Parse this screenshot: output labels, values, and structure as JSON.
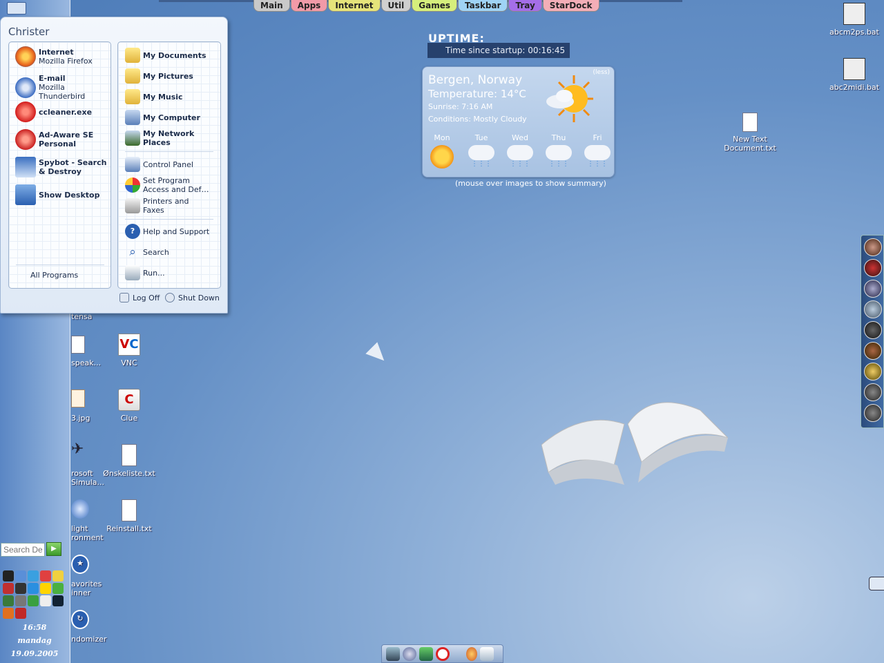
{
  "tabs": [
    {
      "label": "Main",
      "color": "#c9c9c9"
    },
    {
      "label": "Apps",
      "color": "#f29aa8"
    },
    {
      "label": "Internet",
      "color": "#e6e47a"
    },
    {
      "label": "Util",
      "color": "#cfcfcf"
    },
    {
      "label": "Games",
      "color": "#d6ef7c"
    },
    {
      "label": "Taskbar",
      "color": "#9fd3f5"
    },
    {
      "label": "Tray",
      "color": "#a46ee8"
    },
    {
      "label": "StarDock",
      "color": "#f3aeb7"
    }
  ],
  "startmenu": {
    "username": "Christer",
    "pinned": [
      {
        "title": "Internet",
        "subtitle": "Mozilla Firefox",
        "icon": "firefox-icon"
      },
      {
        "title": "E-mail",
        "subtitle": "Mozilla Thunderbird",
        "icon": "thunderbird-icon"
      },
      {
        "title": "ccleaner.exe",
        "subtitle": "",
        "icon": "ccleaner-icon"
      },
      {
        "title": "Ad-Aware SE",
        "subtitle": "Personal",
        "icon": "adaware-icon"
      },
      {
        "title": "Spybot - Search",
        "subtitle": "& Destroy",
        "icon": "spybot-icon"
      },
      {
        "title": "Show Desktop",
        "subtitle": "",
        "icon": "show-desktop-icon"
      }
    ],
    "all_programs": "All Programs",
    "places": [
      {
        "title": "My Documents",
        "icon": "folder-icon"
      },
      {
        "title": "My Pictures",
        "icon": "folder-icon"
      },
      {
        "title": "My Music",
        "icon": "folder-icon"
      },
      {
        "title": "My Computer",
        "icon": "computer-icon"
      },
      {
        "title": "My Network",
        "title2": "Places",
        "icon": "network-icon"
      }
    ],
    "system": [
      {
        "title": "Control Panel",
        "icon": "control-panel-icon"
      },
      {
        "title": "Set Program",
        "title2": "Access and Def…",
        "icon": "set-program-icon"
      },
      {
        "title": "Printers and",
        "title2": "Faxes",
        "icon": "printer-icon"
      }
    ],
    "help": [
      {
        "title": "Help and Support",
        "icon": "help-icon"
      },
      {
        "title": "Search",
        "icon": "search-icon"
      },
      {
        "title": "Run...",
        "icon": "run-icon"
      }
    ],
    "log_off": "Log Off",
    "shut_down": "Shut Down"
  },
  "uptime": {
    "title": "UPTIME:",
    "text": "Time since startup: 00:16:45"
  },
  "weather": {
    "city": "Bergen,  Norway",
    "temperature": "Temperature:  14°C",
    "sunrise": "Sunrise:  7:16  AM",
    "conditions": "Conditions:  Mostly  Cloudy",
    "less": "(less)",
    "days": [
      "Mon",
      "Tue",
      "Wed",
      "Thu",
      "Fri"
    ],
    "hint": "(mouse over images to show summary)"
  },
  "desktop_icons": {
    "right": [
      {
        "label": "abcm2ps.bat"
      },
      {
        "label": "abc2midi.bat"
      },
      {
        "label": "New Text Document.txt"
      }
    ],
    "partial": [
      {
        "label": "tensa"
      },
      {
        "label": "speak..."
      },
      {
        "label": "3.jpg"
      },
      {
        "label": "rosoft Simula..."
      },
      {
        "label": "light ronment"
      },
      {
        "label": "avorites inner"
      },
      {
        "label": "ndomizer"
      }
    ],
    "column": [
      {
        "label": "VNC"
      },
      {
        "label": "Clue"
      },
      {
        "label": "Ønskeliste.txt"
      },
      {
        "label": "Reinstall.txt"
      }
    ]
  },
  "leftbar": {
    "search_placeholder": "Search Desktop",
    "time": "16:58",
    "day": "mandag",
    "date": "19.09.2005"
  }
}
